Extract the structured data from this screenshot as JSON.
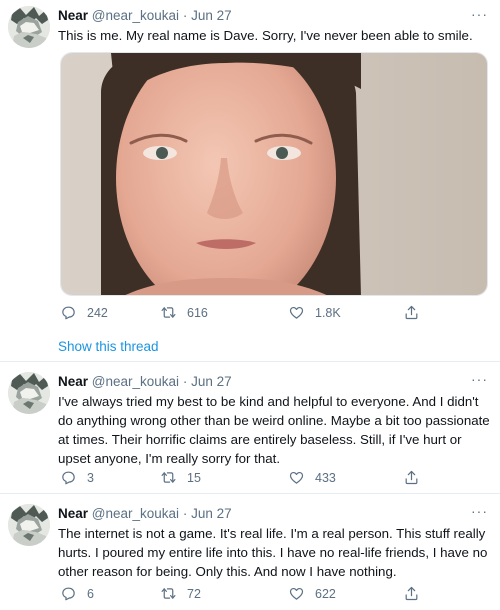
{
  "tweets": [
    {
      "name": "Near",
      "handle": "@near_koukai",
      "separator": "·",
      "date": "Jun 27",
      "text": "This is me. My real name is Dave. Sorry, I've never been able to smile.",
      "replies": "242",
      "retweets": "616",
      "likes": "1.8K"
    },
    {
      "name": "Near",
      "handle": "@near_koukai",
      "separator": "·",
      "date": "Jun 27",
      "text": "I've always tried my best to be kind and helpful to everyone. And I didn't do anything wrong other than be weird online. Maybe a bit too passionate at times. Their horrific claims are entirely baseless. Still, if I've hurt or upset anyone, I'm really sorry for that.",
      "replies": "3",
      "retweets": "15",
      "likes": "433"
    },
    {
      "name": "Near",
      "handle": "@near_koukai",
      "separator": "·",
      "date": "Jun 27",
      "text": "The internet is not a game. It's real life. I'm a real person. This stuff really hurts. I poured my entire life into this. I have no real-life friends, I have no other reason for being. Only this. And now I have nothing.",
      "replies": "6",
      "retweets": "72",
      "likes": "622"
    }
  ],
  "show_thread": "Show this thread",
  "more_label": "···",
  "icons": [
    "reply-icon",
    "retweet-icon",
    "like-icon",
    "share-icon",
    "more-icon"
  ],
  "colors": {
    "link": "#1b95e0",
    "muted": "#5b7083",
    "text": "#0f1419",
    "border": "#e6ecf0"
  }
}
